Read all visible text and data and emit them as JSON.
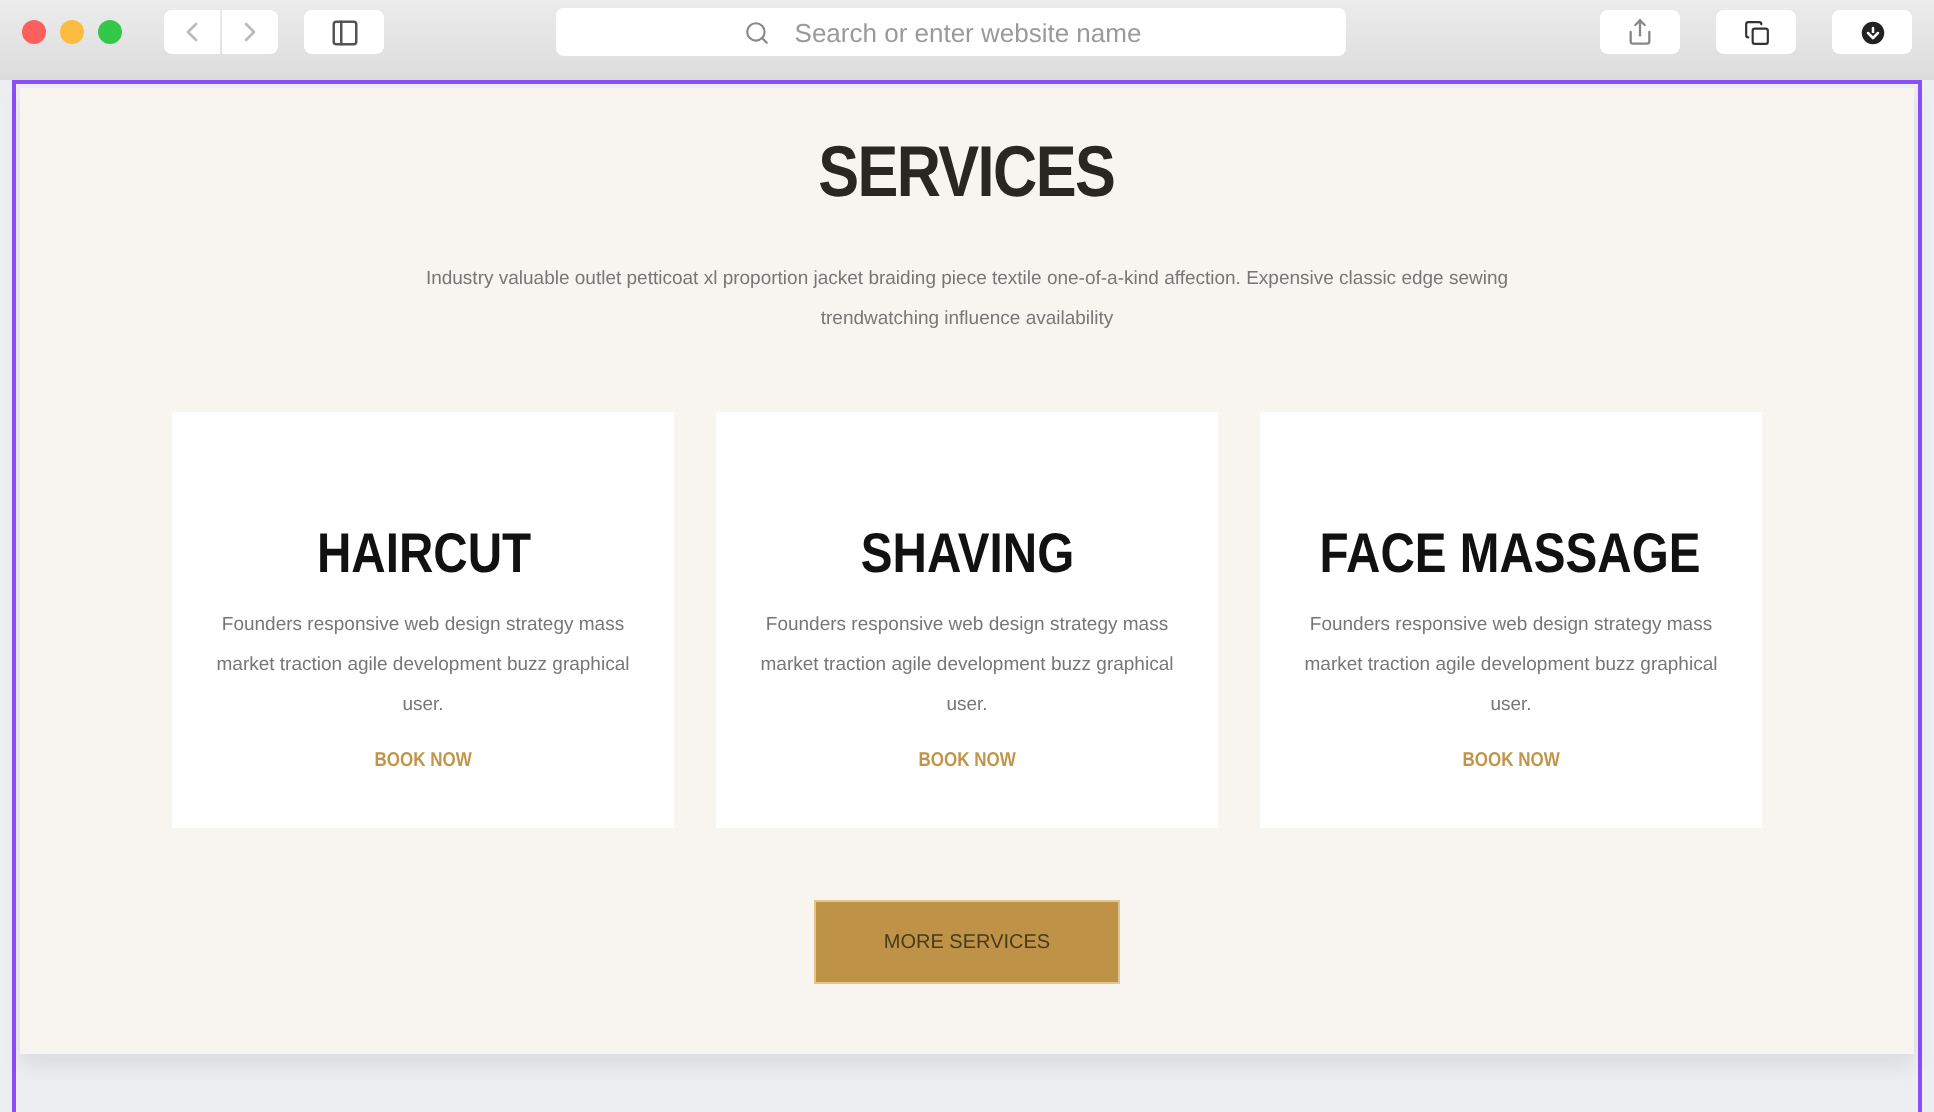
{
  "browser": {
    "search": {
      "placeholder": "Search or enter website name"
    }
  },
  "section": {
    "title": "SERVICES",
    "intro": "Industry valuable outlet petticoat xl proportion jacket braiding piece textile one-of-a-kind affection. Expensive classic edge sewing trendwatching influence availability"
  },
  "cards": [
    {
      "title": "HAIRCUT",
      "text": "Founders responsive web design strategy mass market traction agile development buzz graphical user.",
      "link": "BOOK NOW"
    },
    {
      "title": "SHAVING",
      "text": "Founders responsive web design strategy mass market traction agile development buzz graphical user.",
      "link": "BOOK NOW"
    },
    {
      "title": "FACE MASSAGE",
      "text": "Founders responsive web design strategy mass market traction agile development buzz graphical user.",
      "link": "BOOK NOW"
    }
  ],
  "more_button": "MORE SERVICES"
}
